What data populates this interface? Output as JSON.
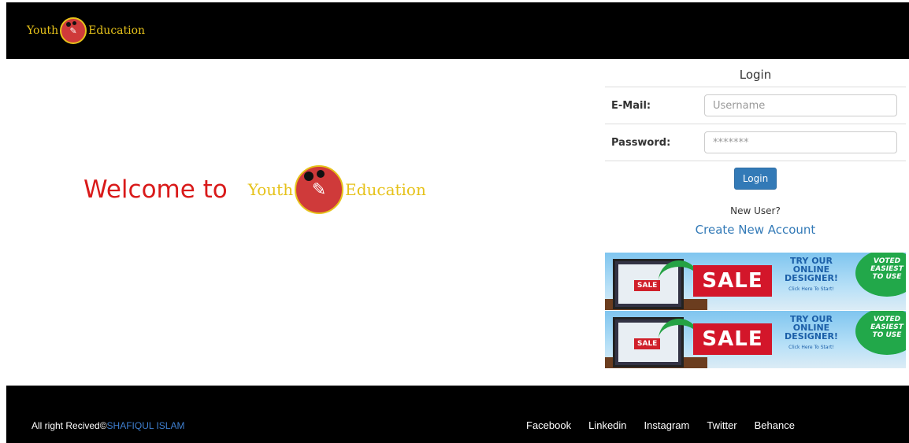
{
  "header": {
    "brand_left": "Youth",
    "brand_right": "Education"
  },
  "welcome": {
    "text": "Welcome to",
    "brand_left": "Youth",
    "brand_right": "Education"
  },
  "login": {
    "title": "Login",
    "email_label": "E-Mail:",
    "email_placeholder": "Username",
    "password_label": "Password:",
    "password_placeholder": "*******",
    "button_label": "Login",
    "new_user_text": "New User?",
    "create_account_label": "Create New Account"
  },
  "ads": [
    {
      "mini_sale": "SALE",
      "sale": "SALE",
      "try_line1": "TRY OUR",
      "try_line2": "ONLINE",
      "try_line3": "DESIGNER!",
      "try_small": "Click Here To Start!",
      "voted_line1": "VOTED",
      "voted_line2": "EASIEST",
      "voted_line3": "TO USE"
    },
    {
      "mini_sale": "SALE",
      "sale": "SALE",
      "try_line1": "TRY OUR",
      "try_line2": "ONLINE",
      "try_line3": "DESIGNER!",
      "try_small": "Click Here To Start!",
      "voted_line1": "VOTED",
      "voted_line2": "EASIEST",
      "voted_line3": "TO USE"
    }
  ],
  "footer": {
    "copyright_prefix": "All right Recived©",
    "copyright_author": "SHAFIQUL ISLAM",
    "links": [
      "Facebook",
      "Linkedin",
      "Instagram",
      "Twitter",
      "Behance"
    ]
  },
  "colors": {
    "brand_gold": "#e6c21a",
    "logo_red": "#cf3a3a",
    "welcome_red": "#d91a1a",
    "primary_blue": "#337ab7"
  }
}
